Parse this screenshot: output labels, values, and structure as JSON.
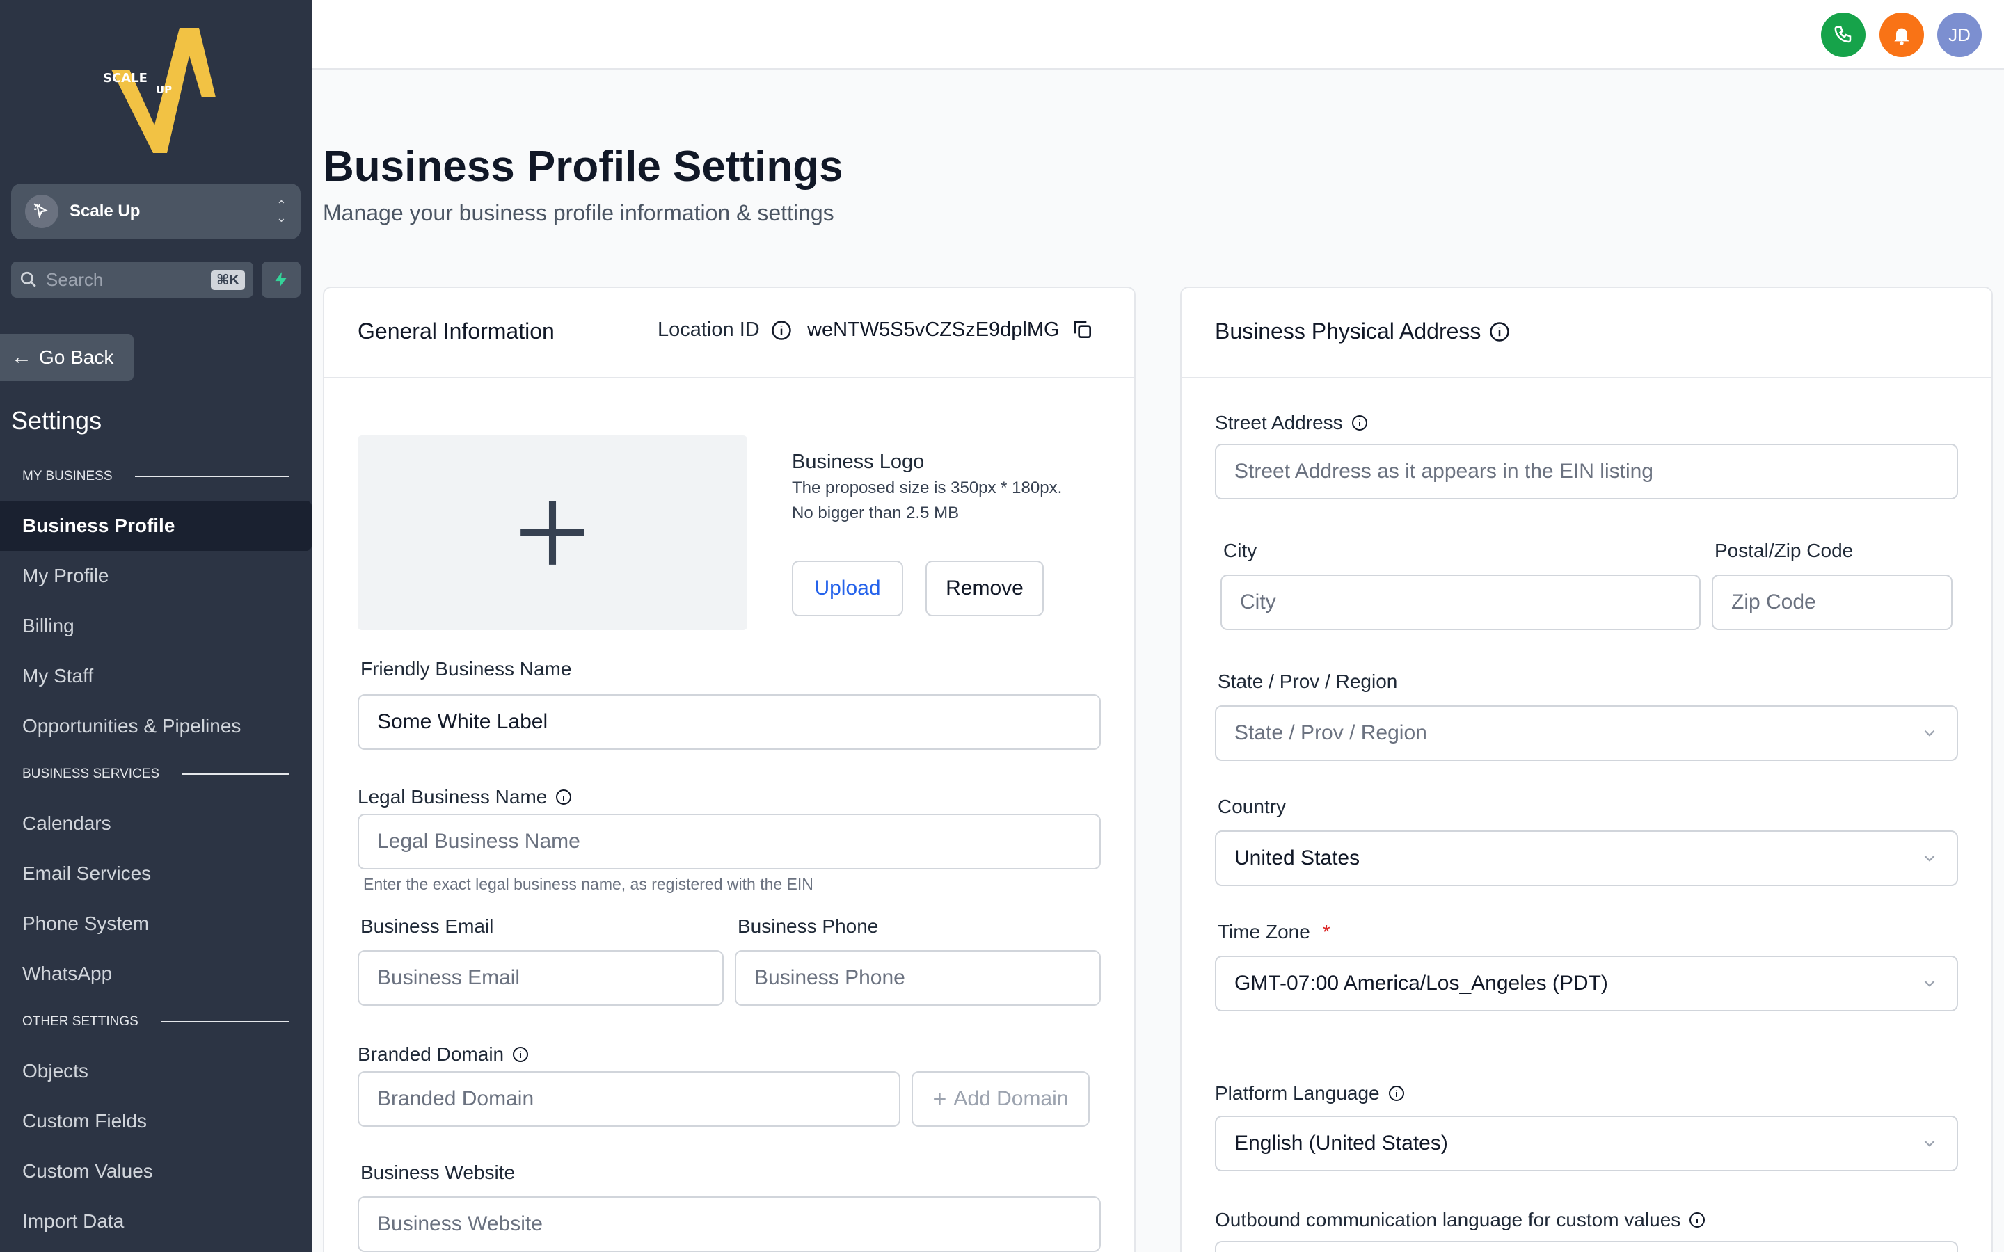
{
  "sidebar": {
    "logo": {
      "top": "SCALE",
      "sub": "UP"
    },
    "account_name": "Scale Up",
    "search_placeholder": "Search",
    "search_shortcut": "⌘K",
    "go_back": "Go Back",
    "settings_title": "Settings",
    "sections": [
      {
        "heading": "MY BUSINESS",
        "items": [
          "Business Profile",
          "My Profile",
          "Billing",
          "My Staff",
          "Opportunities & Pipelines"
        ]
      },
      {
        "heading": "BUSINESS SERVICES",
        "items": [
          "Calendars",
          "Email Services",
          "Phone System",
          "WhatsApp"
        ]
      },
      {
        "heading": "OTHER SETTINGS",
        "items": [
          "Objects",
          "Custom Fields",
          "Custom Values",
          "Import Data"
        ]
      }
    ],
    "active_item": "Business Profile"
  },
  "topbar": {
    "avatar_initials": "JD",
    "colors": {
      "phone": "#16a34a",
      "bell": "#f97316",
      "avatar": "#7c8fd0"
    }
  },
  "page": {
    "title": "Business Profile Settings",
    "subtitle": "Manage your business profile information & settings"
  },
  "general": {
    "title": "General Information",
    "location_label": "Location ID",
    "location_id": "weNTW5S5vCZSzE9dplMG",
    "logo_title": "Business Logo",
    "logo_hint_1": "The proposed size is 350px * 180px.",
    "logo_hint_2": "No bigger than 2.5 MB",
    "upload": "Upload",
    "remove": "Remove",
    "friendly_label": "Friendly Business Name",
    "friendly_value": "Some White Label",
    "legal_label": "Legal Business Name",
    "legal_placeholder": "Legal Business Name",
    "legal_hint": "Enter the exact legal business name, as registered with the EIN",
    "email_label": "Business Email",
    "email_placeholder": "Business Email",
    "phone_label": "Business Phone",
    "phone_placeholder": "Business Phone",
    "domain_label": "Branded Domain",
    "domain_placeholder": "Branded Domain",
    "add_domain": "Add Domain",
    "website_label": "Business Website",
    "website_placeholder": "Business Website"
  },
  "address": {
    "title": "Business Physical Address",
    "street_label": "Street Address",
    "street_placeholder": "Street Address as it appears in the EIN listing",
    "city_label": "City",
    "city_placeholder": "City",
    "zip_label": "Postal/Zip Code",
    "zip_placeholder": "Zip Code",
    "state_label": "State / Prov / Region",
    "state_placeholder": "State / Prov / Region",
    "country_label": "Country",
    "country_value": "United States",
    "timezone_label": "Time Zone",
    "timezone_required": "*",
    "timezone_value": "GMT-07:00 America/Los_Angeles (PDT)",
    "language_label": "Platform Language",
    "language_value": "English (United States)",
    "outbound_label": "Outbound communication language for custom values"
  }
}
